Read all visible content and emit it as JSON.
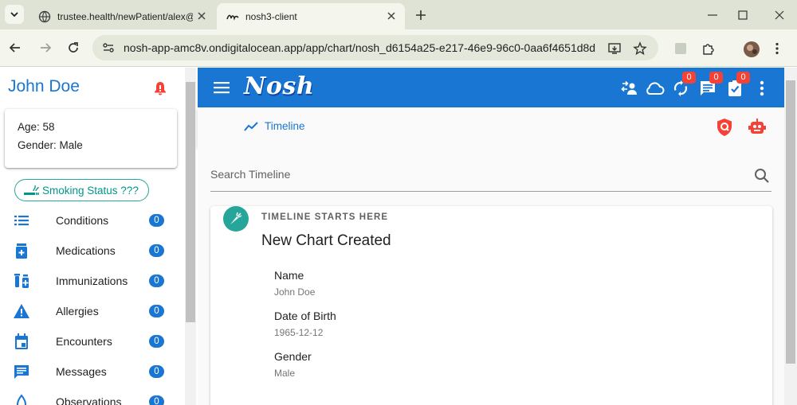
{
  "browser": {
    "tabs": [
      {
        "title": "trustee.health/newPatient/alex@"
      },
      {
        "title": "nosh3-client"
      }
    ],
    "url": "nosh-app-amc8v.ondigitalocean.app/app/chart/nosh_d6154a25-e217-46e9-96c0-0aa6f4651d8d"
  },
  "patient": {
    "name": "John Doe",
    "age_line": "Age: 58",
    "gender_line": "Gender: Male"
  },
  "smoking_chip": "Smoking Status ???",
  "sidebar": {
    "items": [
      {
        "label": "Conditions",
        "count": "0",
        "icon": "list-icon"
      },
      {
        "label": "Medications",
        "count": "0",
        "icon": "pill-bottle-icon"
      },
      {
        "label": "Immunizations",
        "count": "0",
        "icon": "vaccine-icon"
      },
      {
        "label": "Allergies",
        "count": "0",
        "icon": "warning-icon"
      },
      {
        "label": "Encounters",
        "count": "0",
        "icon": "calendar-icon"
      },
      {
        "label": "Messages",
        "count": "0",
        "icon": "message-icon"
      },
      {
        "label": "Observations",
        "count": "0",
        "icon": "observations-icon"
      }
    ]
  },
  "header": {
    "logo": "Nosh",
    "badges": {
      "sync": "0",
      "messages": "0",
      "tasks": "0"
    }
  },
  "subbar": {
    "tab_label": "Timeline"
  },
  "search": {
    "placeholder": "Search Timeline"
  },
  "timeline_card": {
    "overline": "TIMELINE STARTS HERE",
    "title": "New Chart Created",
    "fields": [
      {
        "label": "Name",
        "value": "John Doe"
      },
      {
        "label": "Date of Birth",
        "value": "1965-12-12"
      },
      {
        "label": "Gender",
        "value": "Male"
      }
    ]
  },
  "colors": {
    "primary": "#1976d2",
    "teal": "#26a69a",
    "alert": "#f44336"
  }
}
